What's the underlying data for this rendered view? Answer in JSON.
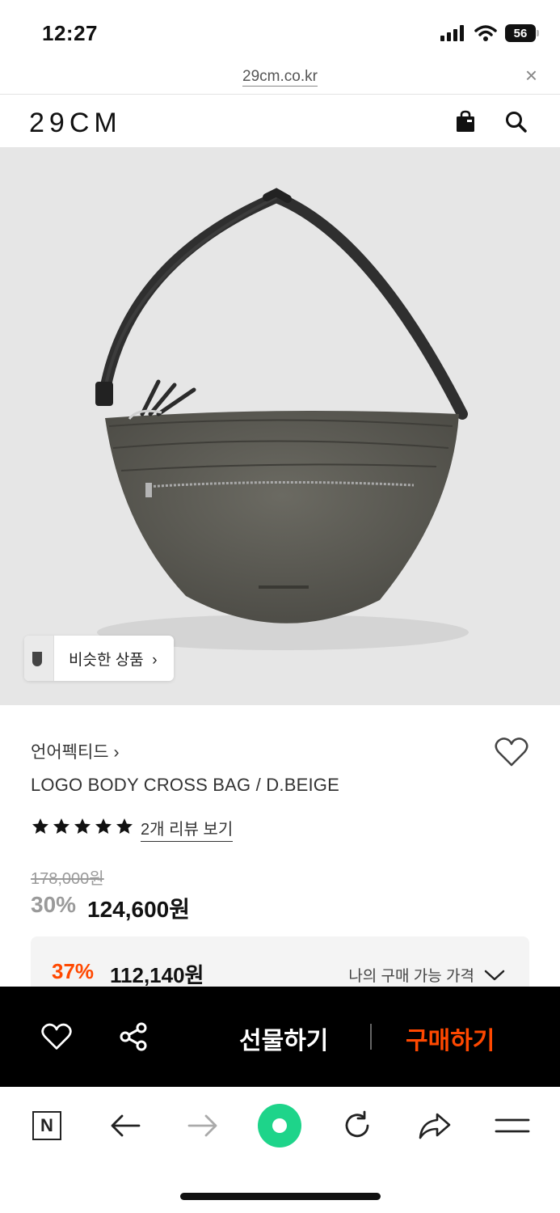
{
  "status_bar": {
    "time": "12:27",
    "battery": "56"
  },
  "url_bar": {
    "domain": "29cm.co.kr",
    "close_icon": "close-icon"
  },
  "header": {
    "logo": "29CM",
    "icons": [
      "shopping-bag-icon",
      "search-icon"
    ]
  },
  "hero": {
    "similar_products_label": "비슷한 상품"
  },
  "product": {
    "brand": "언어펙티드",
    "name": "LOGO BODY CROSS BAG / D.BEIGE",
    "rating_stars": 5,
    "review_link": "2개 리뷰 보기",
    "original_price": "178,000원",
    "discount_percent": "30%",
    "sale_price": "124,600원",
    "benefit": {
      "discount_percent": "37%",
      "price": "112,140원",
      "label": "나의 구매 가능 가격"
    }
  },
  "action_bar": {
    "gift_label": "선물하기",
    "buy_label": "구매하기",
    "buy_color": "#ff4800",
    "icons": [
      "heart-icon",
      "share-icon"
    ]
  },
  "browser_toolbar": {
    "icons": [
      "naver-n-icon",
      "back-arrow-icon",
      "forward-arrow-icon",
      "green-dot-home-icon",
      "reload-icon",
      "share-arrow-icon",
      "menu-icon"
    ],
    "n_label": "N"
  }
}
